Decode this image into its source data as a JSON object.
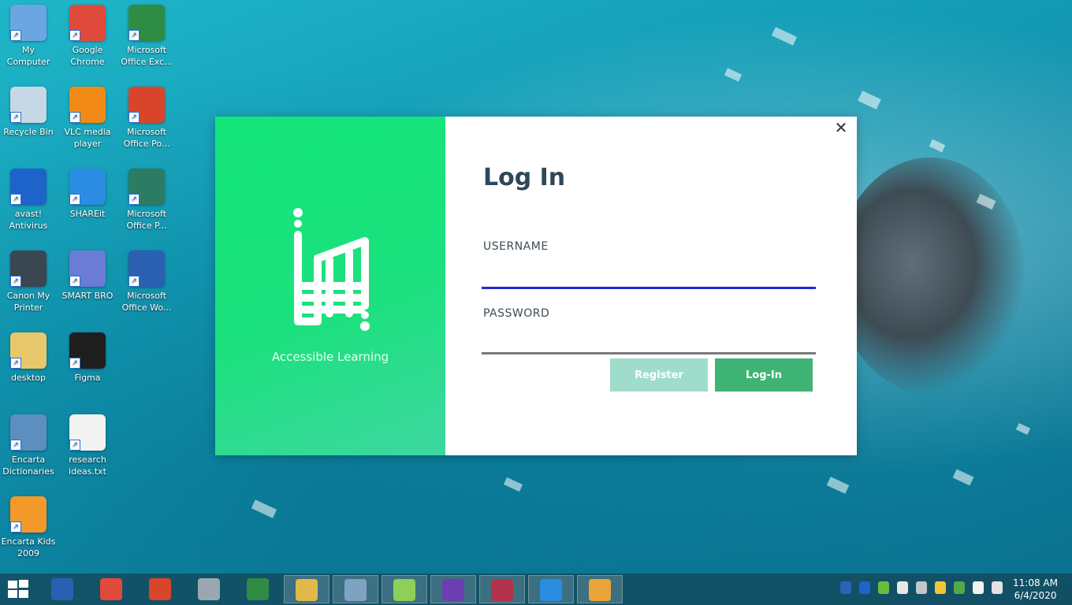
{
  "desktop": {
    "icons": [
      {
        "label": "My\nComputer",
        "icon": "computer-icon",
        "color": "#6aa7e2"
      },
      {
        "label": "Google\nChrome",
        "icon": "chrome-icon",
        "color": "#e04a3a"
      },
      {
        "label": "Microsoft\nOffice Exc...",
        "icon": "excel-icon",
        "color": "#2f8c45"
      },
      {
        "label": "Recycle Bin",
        "icon": "recycle-bin-icon",
        "color": "#c6d7e6"
      },
      {
        "label": "VLC media\nplayer",
        "icon": "vlc-icon",
        "color": "#f28a16"
      },
      {
        "label": "Microsoft\nOffice Po...",
        "icon": "powerpoint-icon",
        "color": "#d8452b"
      },
      {
        "label": "avast!\nAntivirus",
        "icon": "avast-icon",
        "color": "#1d63c9"
      },
      {
        "label": "SHAREit",
        "icon": "shareit-icon",
        "color": "#2a8de2"
      },
      {
        "label": "Microsoft\nOffice P...",
        "icon": "publisher-icon",
        "color": "#2c7b63"
      },
      {
        "label": "Canon My\nPrinter",
        "icon": "printer-icon",
        "color": "#3a4650"
      },
      {
        "label": "SMART BRO",
        "icon": "smart-bro-icon",
        "color": "#6b7bd6"
      },
      {
        "label": "Microsoft\nOffice Wo...",
        "icon": "word-icon",
        "color": "#2a5fb2"
      },
      {
        "label": "desktop",
        "icon": "folder-icon",
        "color": "#e8c86a"
      },
      {
        "label": "Figma",
        "icon": "figma-icon",
        "color": "#1e1e1e"
      },
      {
        "label": "Encarta\nDictionaries",
        "icon": "encarta-dictionaries-icon",
        "color": "#5c8fbf"
      },
      {
        "label": "research\nideas.txt",
        "icon": "text-file-icon",
        "color": "#f2f2f2"
      },
      {
        "label": "Encarta Kids\n2009",
        "icon": "encarta-kids-icon",
        "color": "#f2992a"
      }
    ]
  },
  "dialog": {
    "close_glyph": "✕",
    "brand": "Accessible Learning",
    "title": "Log In",
    "username_label": "USERNAME",
    "password_label": "PASSWORD",
    "username_value": "",
    "password_value": "",
    "register_label": "Register",
    "login_label": "Log-In"
  },
  "taskbar": {
    "apps": [
      {
        "name": "word",
        "color": "#2a5fb2"
      },
      {
        "name": "chrome",
        "color": "#e04a3a"
      },
      {
        "name": "powerpoint",
        "color": "#d8452b"
      },
      {
        "name": "calculator",
        "color": "#9aa7b0"
      },
      {
        "name": "excel",
        "color": "#2f8c45"
      },
      {
        "name": "file-explorer",
        "color": "#e0b94a"
      },
      {
        "name": "task-manager",
        "color": "#7ea3c2"
      },
      {
        "name": "notepad-plus",
        "color": "#8ccf5a"
      },
      {
        "name": "visual-studio",
        "color": "#6b3fb0"
      },
      {
        "name": "access",
        "color": "#b2324b"
      },
      {
        "name": "shareit",
        "color": "#2a8de2"
      },
      {
        "name": "paint-app",
        "color": "#e9a43a"
      }
    ],
    "time": "11:08 AM",
    "date": "6/4/2020"
  }
}
